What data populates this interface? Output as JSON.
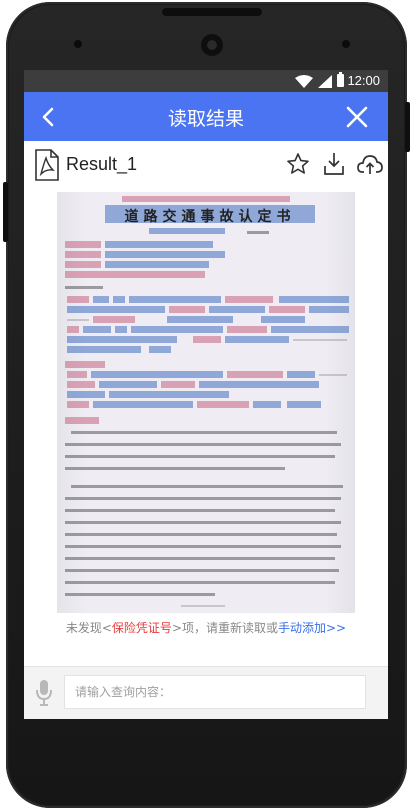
{
  "status_bar": {
    "time": "12:00"
  },
  "app_bar": {
    "title": "读取结果"
  },
  "file": {
    "name": "Result_1"
  },
  "document": {
    "title": "道路交通事故认定书"
  },
  "notice": {
    "prefix": "未发现<",
    "keyword": "保险凭证号",
    "middle": ">项，请重新读取或",
    "action": "手动添加>>"
  },
  "query": {
    "placeholder": "请输入查询内容："
  },
  "colors": {
    "brand": "#4a74f1",
    "warning": "#e83a3a",
    "link": "#3a6fe8",
    "highlight_blue": "#8fa8d8",
    "highlight_pink": "#d9a2b4"
  },
  "icons": [
    "back-arrow-icon",
    "close-icon",
    "pdf-file-icon",
    "star-icon",
    "download-icon",
    "cloud-upload-icon",
    "microphone-icon",
    "wifi-icon",
    "signal-icon",
    "battery-icon"
  ]
}
